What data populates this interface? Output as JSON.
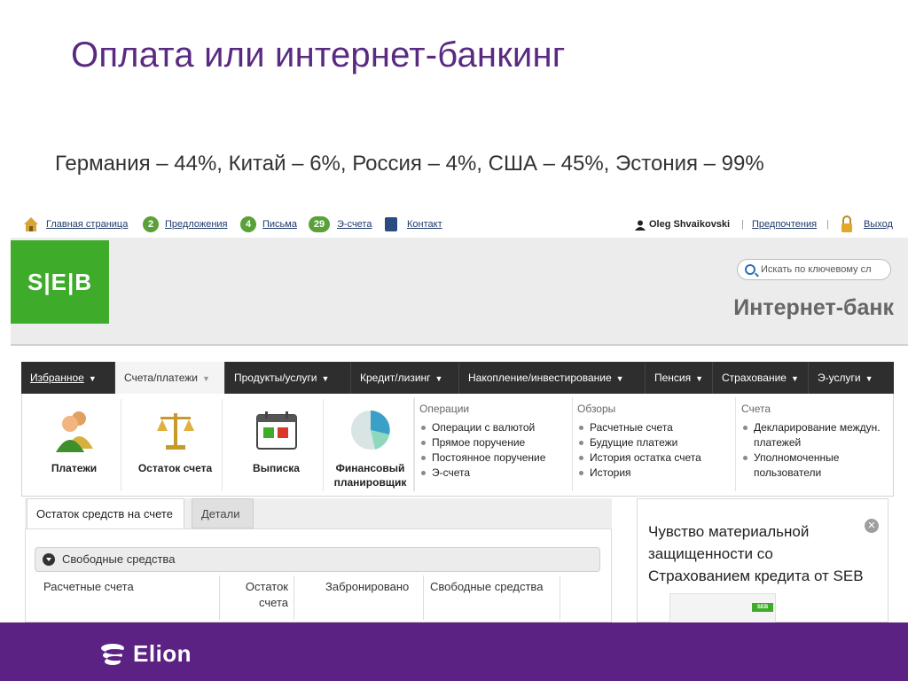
{
  "slide": {
    "title": "Оплата или интернет-банкинг",
    "subtitle": "Германия – 44%, Китай – 6%, Россия – 4%, США – 45%, Эстония – 99%"
  },
  "topbar": {
    "home": "Главная страница",
    "offers_count": "2",
    "offers": "Предложения",
    "letters_count": "4",
    "letters": "Письма",
    "einvoices_count": "29",
    "einvoices": "Э-счета",
    "contact": "Контакт",
    "user": "Oleg Shvaikovski",
    "preferences": "Предпочтения",
    "logout": "Выход"
  },
  "header": {
    "logo": "S|E|B",
    "search_placeholder": "Искать по ключевому сл",
    "bank_name": "Интернет-банк"
  },
  "menu": {
    "items": [
      {
        "label": "Избранное"
      },
      {
        "label": "Счета/платежи"
      },
      {
        "label": "Продукты/услуги"
      },
      {
        "label": "Кредит/лизинг"
      },
      {
        "label": "Накопление/инвестирование"
      },
      {
        "label": "Пенсия"
      },
      {
        "label": "Страхование"
      },
      {
        "label": "Э-услуги"
      }
    ]
  },
  "panel": {
    "tiles": [
      {
        "label": "Платежи",
        "icon": "users-icon"
      },
      {
        "label": "Остаток счета",
        "icon": "scales-icon"
      },
      {
        "label": "Выписка",
        "icon": "calendar-icon"
      },
      {
        "label": "Финансовый планировщик",
        "icon": "pie-chart-icon"
      }
    ],
    "columns": [
      {
        "head": "Операции",
        "items": [
          "Операции с валютой",
          "Прямое поручение",
          "Постоянное поручение",
          "Э-счета"
        ]
      },
      {
        "head": "Обзоры",
        "items": [
          "Расчетные счета",
          "Будущие платежи",
          "История остатка счета",
          "История"
        ]
      },
      {
        "head": "Счета",
        "items": [
          "Декларирование междун. платежей",
          "Уполномоченные пользователи"
        ]
      }
    ]
  },
  "content": {
    "tab_active": "Остаток средств на счете",
    "tab_inactive": "Детали",
    "section": "Свободные средства",
    "headers": [
      "Расчетные счета",
      "Остаток счета",
      "Забронировано",
      "Свободные средства"
    ]
  },
  "promo": {
    "text": "Чувство материальной защищенности со Страхованием кредита от SEB",
    "mini_logo": "SEB"
  },
  "footer": {
    "brand": "Elion"
  },
  "colors": {
    "title": "#5a2a82",
    "footer": "#5b2283",
    "seb_green": "#3eac2a",
    "menu_dark": "#2e2e2e"
  }
}
